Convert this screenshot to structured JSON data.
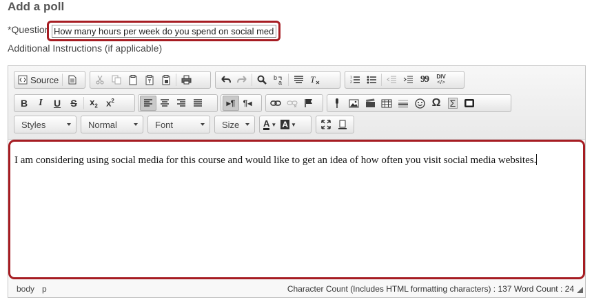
{
  "page_title": "Add a poll",
  "question": {
    "label": "*Question",
    "value": "How many hours per week do you spend on social media?"
  },
  "additional_instructions_label": "Additional Instructions (if applicable)",
  "toolbar": {
    "source_label": "Source",
    "styles_label": "Styles",
    "format_label": "Normal",
    "font_label": "Font",
    "size_label": "Size",
    "text_color_letter": "A",
    "bg_color_letter": "A",
    "bold": "B",
    "italic": "I",
    "underline": "U",
    "strike": "S",
    "subscript": "x",
    "superscript": "x",
    "subscript_mark": "2",
    "superscript_mark": "2",
    "div_label": "DIV",
    "omega": "Ω",
    "sigma": "Σ",
    "quote": "99"
  },
  "editor": {
    "content": "I am considering using social media for this course and would like to get an idea of how often you visit social media websites."
  },
  "status_bar": {
    "path": [
      "body",
      "p"
    ],
    "count_text": "Character Count (Includes HTML formatting characters) : 137 Word Count : 24"
  },
  "colors": {
    "highlight_red": "#a61c22"
  }
}
